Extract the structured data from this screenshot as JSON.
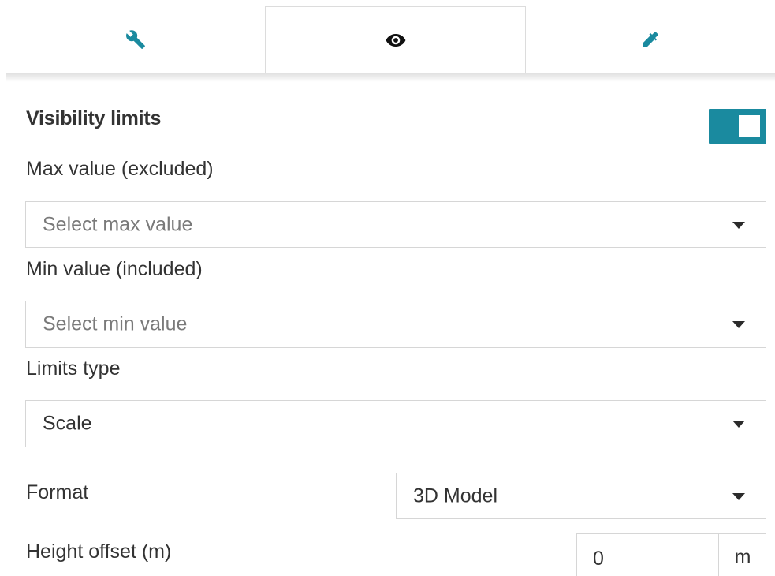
{
  "tabs": [
    {
      "id": "tools",
      "icon": "wrench-icon",
      "active": false
    },
    {
      "id": "visibility",
      "icon": "eye-icon",
      "active": true
    },
    {
      "id": "style",
      "icon": "eyedropper-icon",
      "active": false
    }
  ],
  "colors": {
    "accent": "#1a8a9f",
    "text": "#333333",
    "placeholder": "#7a7a7a",
    "border": "#d6d6d6"
  },
  "visibility_limits": {
    "title": "Visibility limits",
    "enabled": true
  },
  "max_value": {
    "label": "Max value (excluded)",
    "placeholder": "Select max value"
  },
  "min_value": {
    "label": "Min value (included)",
    "placeholder": "Select min value"
  },
  "limits_type": {
    "label": "Limits type",
    "value": "Scale"
  },
  "format": {
    "label": "Format",
    "value": "3D Model"
  },
  "height_offset": {
    "label": "Height offset (m)",
    "value": "0",
    "unit": "m"
  }
}
